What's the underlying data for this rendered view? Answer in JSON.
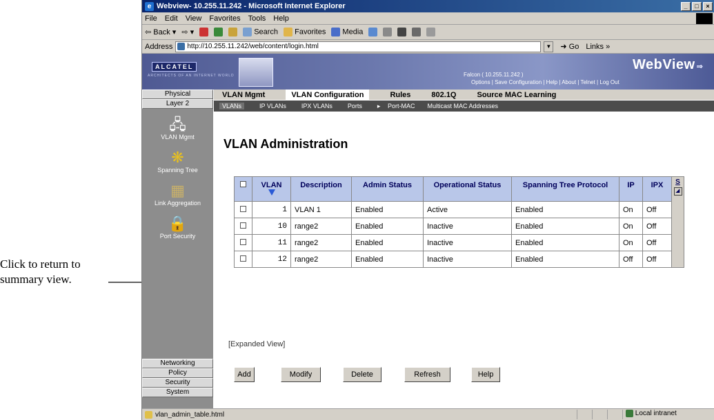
{
  "annotation": {
    "text_line1": "Click to return to",
    "text_line2": "summary view."
  },
  "window": {
    "title": "Webview- 10.255.11.242 - Microsoft Internet Explorer",
    "min": "_",
    "max": "□",
    "close": "×"
  },
  "menu": [
    "File",
    "Edit",
    "View",
    "Favorites",
    "Tools",
    "Help"
  ],
  "toolbar": {
    "back": "Back",
    "search": "Search",
    "favorites": "Favorites",
    "media": "Media"
  },
  "address": {
    "label": "Address",
    "url": "http://10.255.11.242/web/content/login.html",
    "go": "Go",
    "links": "Links »"
  },
  "banner": {
    "brand": "ALCATEL",
    "brand_sub": "ARCHITECTS OF AN INTERNET WORLD",
    "device": "Falcon  ( 10.255.11.242 )",
    "product": "WebView",
    "links": "Options |  Save Configuration | Help | About | Telnet | Log Out"
  },
  "leftnav": {
    "top_buttons": [
      "Physical",
      "Layer 2"
    ],
    "icons": [
      {
        "label": "VLAN Mgmt",
        "icon": "vlan-mgmt-icon"
      },
      {
        "label": "Spanning Tree",
        "icon": "spanning-tree-icon"
      },
      {
        "label": "Link Aggregation",
        "icon": "link-aggregation-icon"
      },
      {
        "label": "Port Security",
        "icon": "port-security-icon"
      }
    ],
    "bottom_buttons": [
      "Networking",
      "Policy",
      "Security",
      "System"
    ]
  },
  "topnav": [
    "VLAN Mgmt",
    "VLAN Configuration",
    "Rules",
    "802.1Q",
    "Source MAC Learning"
  ],
  "subnav": [
    "VLANs",
    "IP VLANs",
    "IPX VLANs",
    "Ports",
    "Port-MAC",
    "Multicast MAC Addresses"
  ],
  "content": {
    "title": "VLAN Administration",
    "columns": [
      "VLAN",
      "Description",
      "Admin Status",
      "Operational Status",
      "Spanning Tree Protocol",
      "IP",
      "IPX",
      "S"
    ],
    "rows": [
      {
        "vlan": "1",
        "description": "VLAN 1",
        "admin": "Enabled",
        "oper": "Active",
        "stp": "Enabled",
        "ip": "On",
        "ipx": "Off"
      },
      {
        "vlan": "10",
        "description": "range2",
        "admin": "Enabled",
        "oper": "Inactive",
        "stp": "Enabled",
        "ip": "On",
        "ipx": "Off"
      },
      {
        "vlan": "11",
        "description": "range2",
        "admin": "Enabled",
        "oper": "Inactive",
        "stp": "Enabled",
        "ip": "On",
        "ipx": "Off"
      },
      {
        "vlan": "12",
        "description": "range2",
        "admin": "Enabled",
        "oper": "Inactive",
        "stp": "Enabled",
        "ip": "Off",
        "ipx": "Off"
      }
    ],
    "expanded_link": "[Expanded View]",
    "buttons": [
      "Add",
      "Modify",
      "Delete",
      "Refresh",
      "Help"
    ]
  },
  "status": {
    "left": "vlan_admin_table.html",
    "zone": "Local intranet"
  }
}
